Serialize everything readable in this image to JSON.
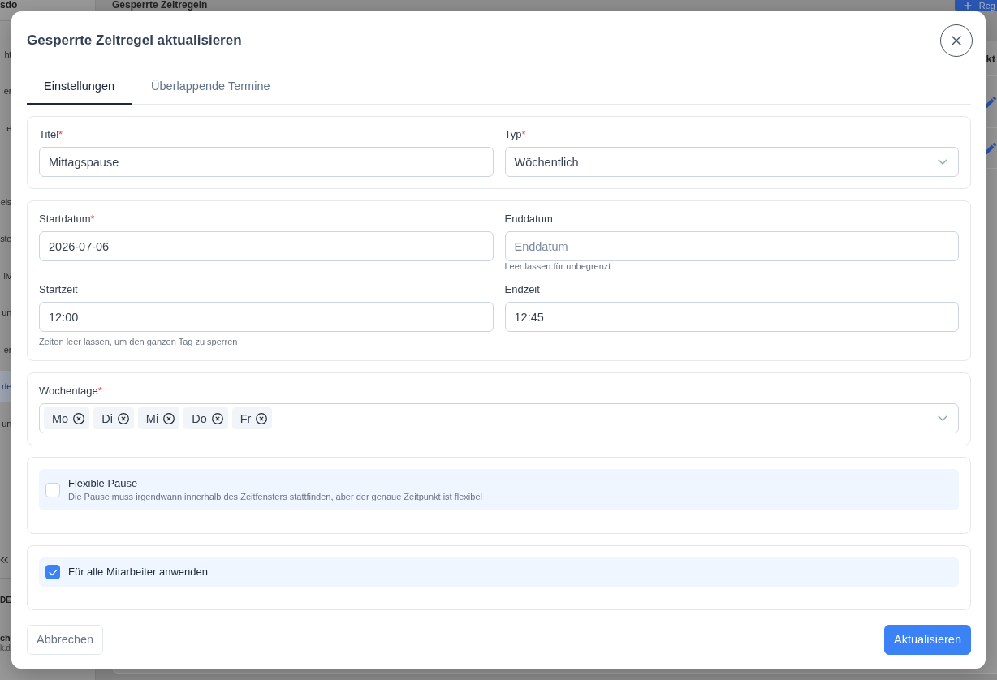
{
  "background": {
    "logo": "sdo",
    "heading": "Gesperrte Zeitregeln",
    "add_button": "Reg",
    "sidebar": {
      "groups": [
        {
          "items": [
            {
              "label": "ht",
              "selected": false
            },
            {
              "label": "er",
              "selected": false
            },
            {
              "label": "e",
              "selected": false
            }
          ]
        },
        {
          "items": [
            {
              "label": "eis",
              "selected": false
            },
            {
              "label": "ste",
              "selected": false
            },
            {
              "label": "llv",
              "selected": false
            },
            {
              "label": "un",
              "selected": false
            },
            {
              "label": "er",
              "selected": false
            },
            {
              "label": "rte",
              "selected": true
            },
            {
              "label": "un",
              "selected": false
            }
          ]
        }
      ],
      "language": "DE",
      "user_name": "ch",
      "user_email": "k.d"
    },
    "table": {
      "header": "kt"
    }
  },
  "dialog": {
    "title": "Gesperrte Zeitregel aktualisieren",
    "tabs": [
      {
        "label": "Einstellungen",
        "selected": true
      },
      {
        "label": "Überlappende Termine",
        "selected": false
      }
    ],
    "sections": [
      {
        "fields": [
          {
            "kind": "text",
            "label": "Titel",
            "required_mark": "*",
            "value": "Mittagspause"
          },
          {
            "kind": "select",
            "label": "Typ",
            "required_mark": "*",
            "value": "Wöchentlich"
          }
        ]
      },
      {
        "fields": [
          {
            "kind": "text",
            "label": "Startdatum",
            "required_mark": "*",
            "value": "2026-07-06"
          },
          {
            "kind": "text",
            "label": "Enddatum",
            "placeholder": "Enddatum",
            "hint": "Leer lassen für unbegrenzt"
          },
          {
            "kind": "text",
            "label": "Startzeit",
            "value": "12:00"
          },
          {
            "kind": "text",
            "label": "Endzeit",
            "value": "12:45"
          }
        ],
        "note": "Zeiten leer lassen, um den ganzen Tag zu sperren"
      },
      {
        "fields": [
          {
            "kind": "multiselect",
            "label": "Wochentage",
            "required_mark": "*",
            "chips": [
              "Mo",
              "Di",
              "Mi",
              "Do",
              "Fr"
            ]
          }
        ]
      },
      {
        "fields": [
          {
            "kind": "checkbox",
            "label": "Flexible Pause",
            "description": "Die Pause muss irgendwann innerhalb des Zeitfensters stattfinden, aber der genaue Zeitpunkt ist flexibel",
            "checked": false
          }
        ]
      },
      {
        "fields": [
          {
            "kind": "checkbox",
            "label": "Für alle Mitarbeiter anwenden",
            "checked": true
          }
        ]
      }
    ],
    "buttons": [
      {
        "kind": "secondary",
        "label": "Abbrechen"
      },
      {
        "kind": "primary",
        "label": "Aktualisieren"
      }
    ]
  }
}
